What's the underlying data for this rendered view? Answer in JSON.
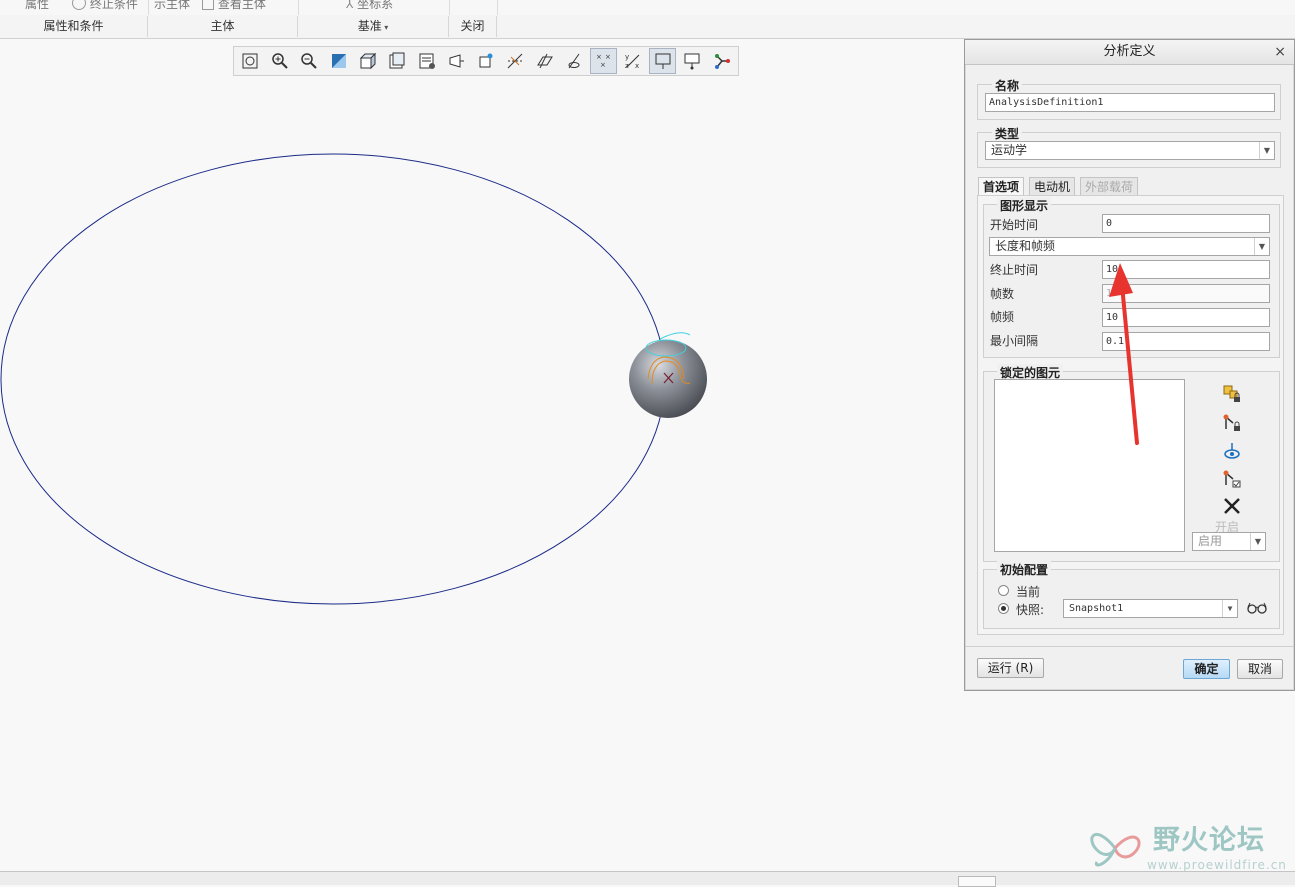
{
  "ribbon": {
    "top_items": [
      "属性",
      "终止条件",
      "示主体",
      "查看主体",
      "坐标系"
    ],
    "groups": [
      "属性和条件",
      "主体",
      "基准",
      "关闭"
    ]
  },
  "view_toolbar": {
    "tools": [
      "refit-icon",
      "zoom-in-icon",
      "zoom-out-icon",
      "repaint-icon",
      "display-style-icon",
      "saved-views-icon",
      "view-manager-icon",
      "perspective-icon",
      "spin-center-icon",
      "datum-display-icon",
      "plane-display-icon",
      "axis-display-icon",
      "point-display-icon",
      "csys-display-icon",
      "annotation-display-icon",
      "mechanism-display-icon",
      "connection-icon"
    ]
  },
  "dialog": {
    "title": "分析定义",
    "close": "×",
    "name_group": "名称",
    "name_value": "AnalysisDefinition1",
    "type_group": "类型",
    "type_value": "运动学",
    "tabs": [
      "首选项",
      "电动机",
      "外部载荷"
    ],
    "graphics_group": "图形显示",
    "start_time_label": "开始时间",
    "start_time_value": "0",
    "mode_value": "长度和帧频",
    "end_time_label": "终止时间",
    "end_time_value": "10",
    "frames_label": "帧数",
    "frames_value": "1",
    "frame_rate_label": "帧频",
    "frame_rate_value": "10",
    "min_interval_label": "最小间隔",
    "min_interval_value": "0.1",
    "locked_group": "锁定的图元",
    "separate_label": "开启",
    "enable_value": "启用",
    "init_group": "初始配置",
    "current_label": "当前",
    "snapshot_label": "快照:",
    "snapshot_value": "Snapshot1",
    "run_button": "运行 (R)",
    "ok_button": "确定",
    "cancel_button": "取消"
  },
  "watermark": {
    "name": "野火论坛",
    "url": "www.proewildfire.cn"
  }
}
